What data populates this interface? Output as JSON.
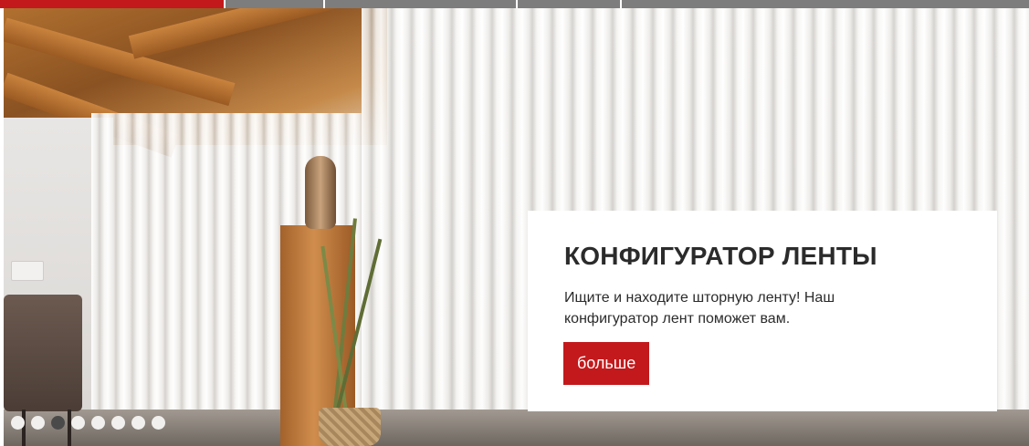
{
  "nav": {
    "segments": [
      {
        "id": "nav-seg-1",
        "active": true
      },
      {
        "id": "nav-seg-2",
        "active": false
      },
      {
        "id": "nav-seg-3",
        "active": false
      },
      {
        "id": "nav-seg-4",
        "active": false
      },
      {
        "id": "nav-seg-5",
        "active": false
      }
    ]
  },
  "slide": {
    "title": "КОНФИГУРАТОР ЛЕНТЫ",
    "text": "Ищите и находите шторную ленту! Наш конфигуратор лент поможет вам.",
    "button_label": "больше"
  },
  "carousel": {
    "total_slides": 8,
    "active_index": 2
  },
  "colors": {
    "accent": "#c3191c",
    "nav_gray": "#7d7d7d",
    "dot_inactive": "#f1f0ee",
    "dot_active": "#4a4a4a"
  }
}
